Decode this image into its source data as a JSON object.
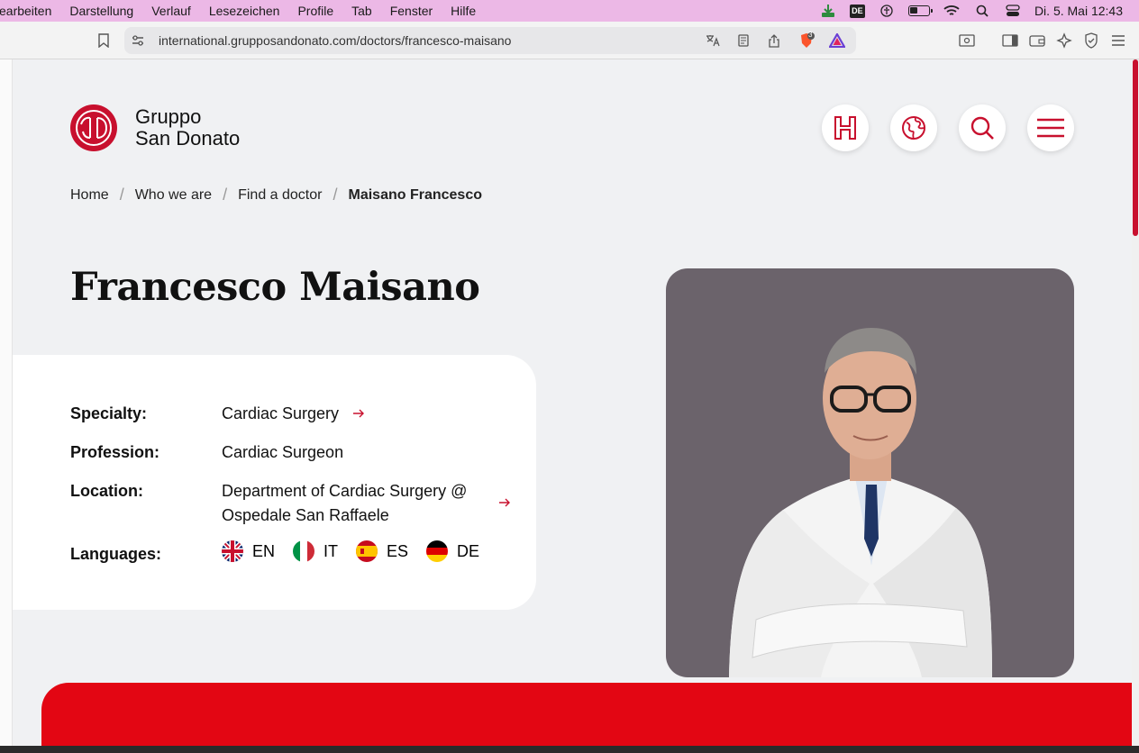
{
  "menubar": {
    "items": [
      "earbeiten",
      "Darstellung",
      "Verlauf",
      "Lesezeichen",
      "Profile",
      "Tab",
      "Fenster",
      "Hilfe"
    ],
    "input_badge": "DE",
    "clock": "Di. 5. Mai  12:43"
  },
  "browser": {
    "url": "international.grupposandonato.com/doctors/francesco-maisano",
    "shield_count": "3"
  },
  "site": {
    "logo_line1": "Gruppo",
    "logo_line2": "San Donato",
    "brand_color": "#c8102e"
  },
  "breadcrumb": {
    "items": [
      "Home",
      "Who we are",
      "Find a doctor"
    ],
    "current": "Maisano Francesco"
  },
  "doctor": {
    "name": "Francesco Maisano",
    "specialty_label": "Specialty:",
    "specialty": "Cardiac Surgery",
    "profession_label": "Profession:",
    "profession": "Cardiac Surgeon",
    "location_label": "Location:",
    "location_line1": "Department of Cardiac Surgery @",
    "location_line2": "Ospedale San Raffaele",
    "languages_label": "Languages:",
    "languages": [
      "EN",
      "IT",
      "ES",
      "DE"
    ]
  }
}
